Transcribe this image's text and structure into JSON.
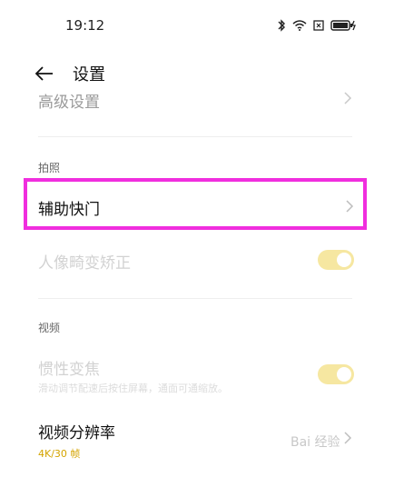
{
  "status": {
    "time": "19:12"
  },
  "header": {
    "title": "设置"
  },
  "rows": {
    "advanced": "高级设置",
    "photo_section": "拍照",
    "assist_shutter": "辅助快门",
    "portrait_distortion": "人像畸变矫正",
    "video_section": "视频",
    "inertial_zoom": "惯性变焦",
    "inertial_zoom_desc": "滑动调节配速后按住屏幕，通面可通缩放。",
    "video_resolution": "视频分辨率",
    "video_resolution_value": "4K/30 帧"
  },
  "toggles": {
    "portrait_distortion": true,
    "inertial_zoom": true
  },
  "watermark": "Bai 经验"
}
